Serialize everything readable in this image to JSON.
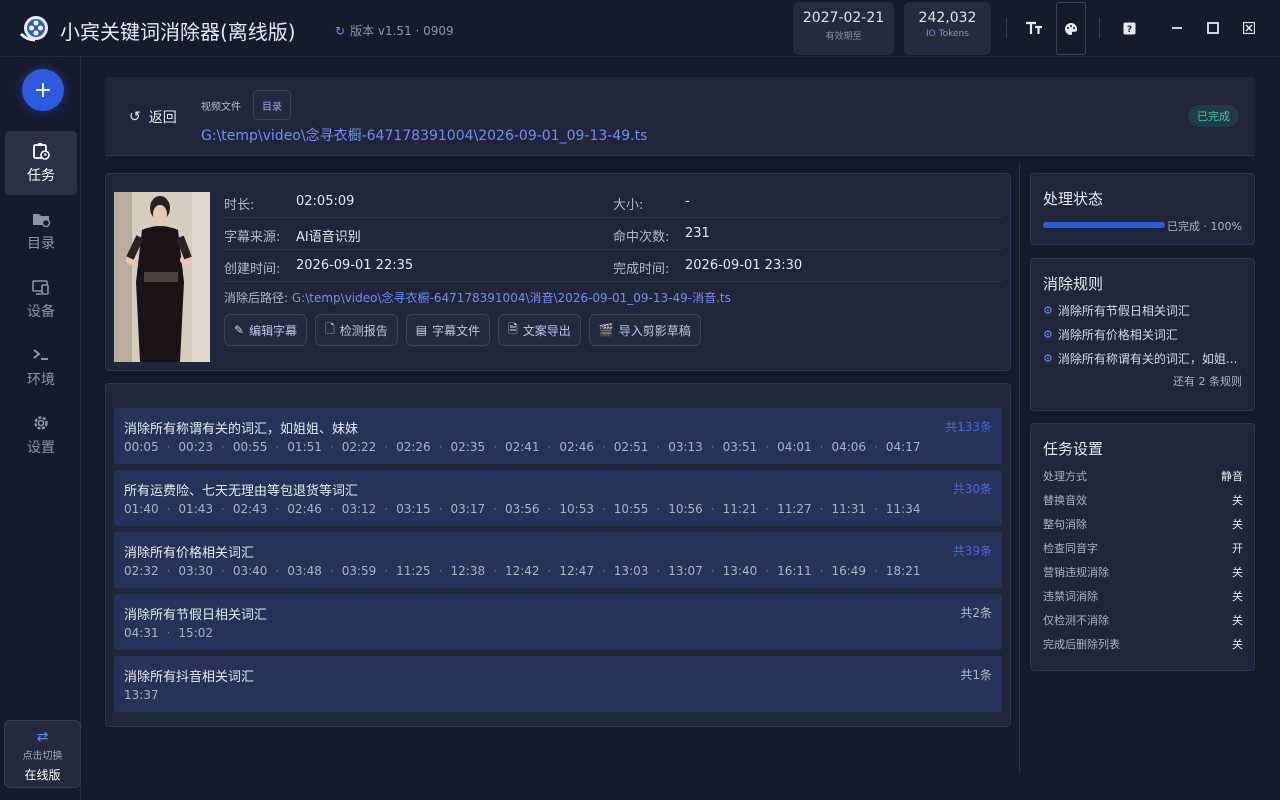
{
  "app": {
    "title": "小宾关键词消除器(离线版)",
    "version": "版本 v1.51 · 0909",
    "expiry_date": "2027-02-21",
    "expiry_label": "有效期至",
    "tokens_value": "242,032",
    "tokens_prefix": "IO",
    "tokens_label": "Tokens"
  },
  "sidebar": {
    "add_label": "+",
    "items": [
      {
        "label": "任务",
        "icon": "task-icon",
        "active": true
      },
      {
        "label": "目录",
        "icon": "folder-settings-icon",
        "active": false
      },
      {
        "label": "设备",
        "icon": "devices-icon",
        "active": false
      },
      {
        "label": "环境",
        "icon": "terminal-icon",
        "active": false
      },
      {
        "label": "设置",
        "icon": "gear-icon",
        "active": false
      }
    ],
    "switch_line1": "点击切换",
    "switch_line2": "在线版"
  },
  "header": {
    "back_label": "返回",
    "video_file_label": "视频文件",
    "dir_button": "目录",
    "file_path": "G:\\temp\\video\\念寻衣橱-647178391004\\2026-09-01_09-13-49.ts",
    "status_badge": "已完成"
  },
  "info": {
    "duration_label": "时长:",
    "duration": "02:05:09",
    "size_label": "大小:",
    "size": "-",
    "subtitle_source_label": "字幕来源:",
    "subtitle_source": "AI语音识别",
    "hits_label": "命中次数:",
    "hits": "231",
    "created_label": "创建时间:",
    "created": "2026-09-01 22:35",
    "finished_label": "完成时间:",
    "finished": "2026-09-01 23:30",
    "output_path_label": "消除后路径:",
    "output_path": "G:\\temp\\video\\念寻衣橱-647178391004\\消音\\2026-09-01_09-13-49-消音.ts",
    "actions": [
      {
        "label": "编辑字幕",
        "icon": "pencil-icon"
      },
      {
        "label": "检测报告",
        "icon": "report-icon"
      },
      {
        "label": "字幕文件",
        "icon": "subtitle-icon"
      },
      {
        "label": "文案导出",
        "icon": "export-doc-icon"
      },
      {
        "label": "导入剪影草稿",
        "icon": "clapper-icon"
      }
    ]
  },
  "results": [
    {
      "title": "消除所有称谓有关的词汇，如姐姐、妹妹",
      "count": "共133条",
      "highlight": true,
      "times": [
        "00:05",
        "00:23",
        "00:55",
        "01:51",
        "02:22",
        "02:26",
        "02:35",
        "02:41",
        "02:46",
        "02:51",
        "03:13",
        "03:51",
        "04:01",
        "04:06",
        "04:17"
      ]
    },
    {
      "title": "所有运费险、七天无理由等包退货等词汇",
      "count": "共30条",
      "highlight": true,
      "times": [
        "01:40",
        "01:43",
        "02:43",
        "02:46",
        "03:12",
        "03:15",
        "03:17",
        "03:56",
        "10:53",
        "10:55",
        "10:56",
        "11:21",
        "11:27",
        "11:31",
        "11:34"
      ]
    },
    {
      "title": "消除所有价格相关词汇",
      "count": "共39条",
      "highlight": true,
      "times": [
        "02:32",
        "03:30",
        "03:40",
        "03:48",
        "03:59",
        "11:25",
        "12:38",
        "12:42",
        "12:47",
        "13:03",
        "13:07",
        "13:40",
        "16:11",
        "16:49",
        "18:21"
      ]
    },
    {
      "title": "消除所有节假日相关词汇",
      "count": "共2条",
      "highlight": false,
      "times": [
        "04:31",
        "15:02"
      ]
    },
    {
      "title": "消除所有抖音相关词汇",
      "count": "共1条",
      "highlight": false,
      "times": [
        "13:37"
      ]
    }
  ],
  "status_panel": {
    "title": "处理状态",
    "progress_text": "已完成 · 100%",
    "progress": 1.0
  },
  "rules_panel": {
    "title": "消除规则",
    "rules": [
      "消除所有节假日相关词汇",
      "消除所有价格相关词汇",
      "消除所有称谓有关的词汇，如姐..."
    ],
    "more": "还有 2 条规则"
  },
  "settings_panel": {
    "title": "任务设置",
    "rows": [
      {
        "key": "处理方式",
        "value": "静音"
      },
      {
        "key": "替换音效",
        "value": "关"
      },
      {
        "key": "整句消除",
        "value": "关"
      },
      {
        "key": "检查同音字",
        "value": "开"
      },
      {
        "key": "营销违规消除",
        "value": "关"
      },
      {
        "key": "违禁词消除",
        "value": "关"
      },
      {
        "key": "仅检测不消除",
        "value": "关"
      },
      {
        "key": "完成后删除列表",
        "value": "关"
      }
    ]
  },
  "colors": {
    "accent": "#2d5be0",
    "link": "#6d8df0",
    "success": "#3cc8a0",
    "background": "#161b2c",
    "card": "#202639"
  }
}
